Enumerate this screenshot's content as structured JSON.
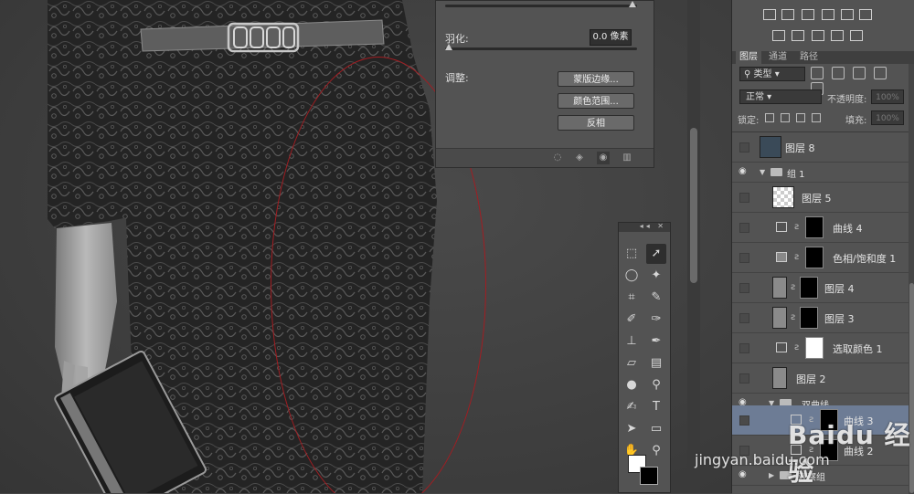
{
  "refine_panel": {
    "feather_label": "羽化:",
    "feather_value": "0.0 像素",
    "adjust_label": "调整:",
    "btn_mask_edge": "蒙版边缘...",
    "btn_color_range": "颜色范围...",
    "btn_invert": "反相"
  },
  "layers_panel": {
    "tabs": [
      "图层",
      "通道",
      "路径"
    ],
    "filter_kind": "类型",
    "blend_mode": "正常",
    "opacity_label": "不透明度:",
    "opacity_value": "100%",
    "lock_label": "锁定:",
    "fill_label": "填充:",
    "fill_value": "100%",
    "layers": [
      {
        "name": "图层 8"
      },
      {
        "name": "组 1"
      },
      {
        "name": "图层 5"
      },
      {
        "name": "曲线 4"
      },
      {
        "name": "色相/饱和度 1"
      },
      {
        "name": "图层 4"
      },
      {
        "name": "图层 3"
      },
      {
        "name": "选取颜色 1"
      },
      {
        "name": "图层 2"
      },
      {
        "name": "双曲线"
      },
      {
        "name": "曲线 3"
      },
      {
        "name": "曲线 2"
      },
      {
        "name": "观察组"
      }
    ]
  },
  "tools": {
    "text_tool_glyph": "T"
  },
  "watermark": {
    "brand": "Baidu 经验",
    "url": "jingyan.baidu.com"
  },
  "colors": {
    "selection_ellipse": "#a21d22",
    "selected_row": "#6d7c95",
    "panel_bg": "#535353"
  }
}
